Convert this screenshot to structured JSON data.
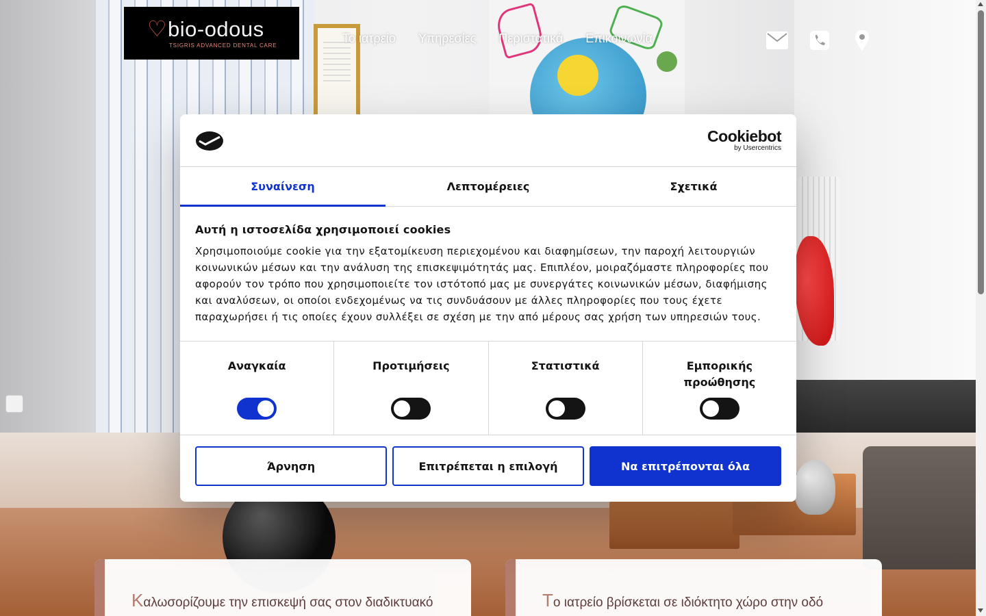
{
  "site": {
    "logo": {
      "name": "bio-odous",
      "tagline": "TSIGRIS ADVANCED DENTAL CARE",
      "heart_glyph": "♡"
    },
    "nav": [
      "Το ιατρείο",
      "Υπηρεσίες",
      "Περιστατικά",
      "Επικοινωνία"
    ],
    "contact_icons": [
      "envelope-icon",
      "phone-icon",
      "map-marker-icon"
    ]
  },
  "cookie_dialog": {
    "brand": {
      "name": "Cookiebot",
      "sub": "by Usercentrics"
    },
    "tabs": [
      {
        "label": "Συναίνεση",
        "active": true
      },
      {
        "label": "Λεπτομέρειες",
        "active": false
      },
      {
        "label": "Σχετικά",
        "active": false
      }
    ],
    "heading": "Αυτή η ιστοσελίδα χρησιμοποιεί cookies",
    "text": "Χρησιμοποιούμε cookie για την εξατομίκευση περιεχομένου και διαφημίσεων, την παροχή λειτουργιών κοινωνικών μέσων και την ανάλυση της επισκεψιμότητάς μας. Επιπλέον, μοιραζόμαστε πληροφορίες που αφορούν τον τρόπο που χρησιμοποιείτε τον ιστότοπό μας με συνεργάτες κοινωνικών μέσων, διαφήμισης και αναλύσεων, οι οποίοι ενδεχομένως να τις συνδυάσουν με άλλες πληροφορίες που τους έχετε παραχωρήσει ή τις οποίες έχουν συλλέξει σε σχέση με την από μέρους σας χρήση των υπηρεσιών τους.",
    "toggles": [
      {
        "label": "Αναγκαία",
        "on": true
      },
      {
        "label": "Προτιμήσεις",
        "on": false
      },
      {
        "label": "Στατιστικά",
        "on": false
      },
      {
        "label": "Εμπορικής προώθησης",
        "on": false
      }
    ],
    "buttons": {
      "deny": "Άρνηση",
      "allow_selection": "Επιτρέπεται η επιλογή",
      "allow_all": "Να επιτρέπονται όλα"
    },
    "colors": {
      "accent": "#1032cf",
      "text": "#141414"
    }
  },
  "cards": [
    {
      "dropcap": "Κ",
      "text": "αλωσορίζουμε την επισκεψή σας στον διαδικτυακό"
    },
    {
      "dropcap": "Τ",
      "text": "ο ιατρείο βρίσκεται σε ιδιόκτητο χώρο στην οδό"
    }
  ]
}
